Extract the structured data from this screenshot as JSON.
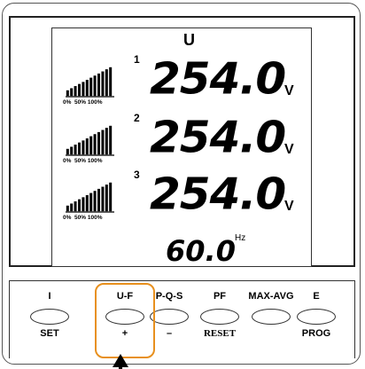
{
  "display": {
    "mode": "U",
    "rows": [
      {
        "phase": "1",
        "value": "254.0",
        "unit": "V",
        "scale": [
          "0%",
          "50%",
          "100%"
        ],
        "level": 1.0
      },
      {
        "phase": "2",
        "value": "254.0",
        "unit": "V",
        "scale": [
          "0%",
          "50%",
          "100%"
        ],
        "level": 1.0
      },
      {
        "phase": "3",
        "value": "254.0",
        "unit": "V",
        "scale": [
          "0%",
          "50%",
          "100%"
        ],
        "level": 1.0
      }
    ],
    "frequency": {
      "value": "60.0",
      "unit": "Hz"
    }
  },
  "buttons": [
    {
      "top": "I",
      "bottom": "SET"
    },
    {
      "top": "U-F",
      "bottom": "+"
    },
    {
      "top": "P-Q-S",
      "bottom": "–"
    },
    {
      "top": "PF",
      "bottom": "RESET"
    },
    {
      "top": "MAX-AVG",
      "bottom": ""
    },
    {
      "top": "E",
      "bottom": "PROG"
    }
  ],
  "colors": {
    "highlight": "#e8901e",
    "lcd_text": "#000000"
  }
}
